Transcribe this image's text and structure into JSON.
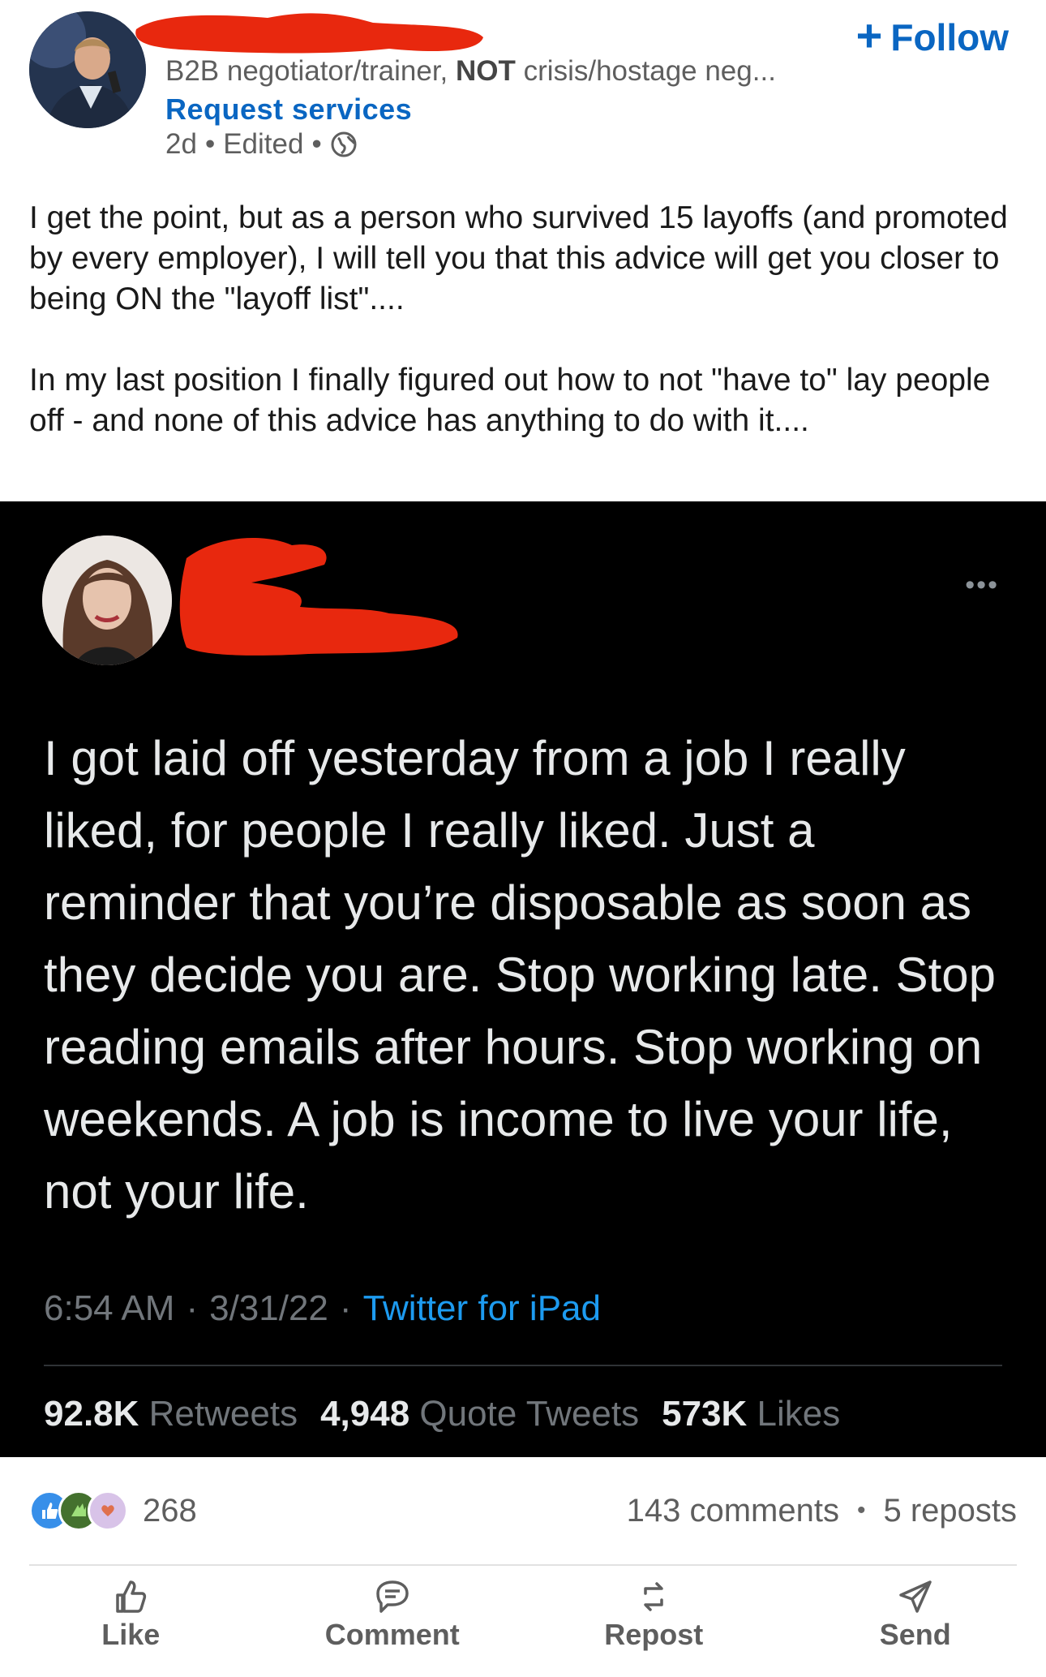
{
  "post": {
    "follow_label": "Follow",
    "headline_prefix": "B2B negotiator/trainer,",
    "headline_bold": "NOT",
    "headline_suffix": "crisis/hostage neg...",
    "request_link": "Request services",
    "time": "2d",
    "edited": "Edited",
    "body_p1": "I get the point, but as a person who survived 15 layoffs (and promoted by every employer), I will tell you that this advice will get you closer to being ON the \"layoff list\"....",
    "body_p2": "In my last position I finally figured out how to not \"have to\" lay people off - and none of this advice has anything to do with it...."
  },
  "tweet": {
    "more": "•••",
    "text": "I got laid off yesterday from a job I really liked, for people I really liked. Just a reminder that you’re disposable as soon as they decide you are. Stop working late. Stop reading emails after hours. Stop working on weekends. A job is income to live your life, not your life.",
    "time": "6:54 AM",
    "date": "3/31/22",
    "source": "Twitter for iPad",
    "retweets_count": "92.8K",
    "retweets_label": "Retweets",
    "quotes_count": "4,948",
    "quotes_label": "Quote Tweets",
    "likes_count": "573K",
    "likes_label": "Likes"
  },
  "social": {
    "reactions_count": "268",
    "comments": "143 comments",
    "reposts": "5 reposts",
    "reaction_icons": [
      "like-icon",
      "celebrate-icon",
      "support-icon"
    ]
  },
  "actions": {
    "like": "Like",
    "comment": "Comment",
    "repost": "Repost",
    "send": "Send"
  },
  "colors": {
    "accent": "#0a66c2",
    "redaction": "#e8280e",
    "tweet_bg": "#000000",
    "tweet_link": "#1d9bf0"
  }
}
